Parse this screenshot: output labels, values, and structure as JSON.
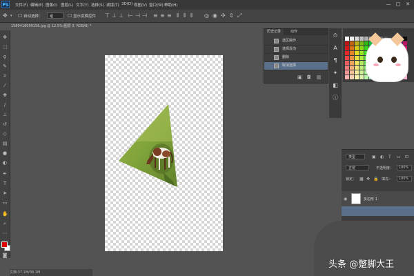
{
  "app": {
    "logo": "Ps"
  },
  "menubar": {
    "items": [
      "文件(F)",
      "编辑(E)",
      "图像(I)",
      "图层(L)",
      "文字(Y)",
      "选择(S)",
      "滤镜(T)",
      "3D(D)",
      "视图(V)",
      "窗口(W)",
      "帮助(H)"
    ],
    "window_controls": [
      "—",
      "□",
      "✕"
    ]
  },
  "optionsbar": {
    "auto_select_label": "自动选择：",
    "auto_select_value": "组",
    "show_transform_label": "显示变换控件"
  },
  "document": {
    "tab_title": "1580418099156.jpg @ 12.5%(图层 0, RGB/8) *",
    "status_text": "文档:37.1M/38.1M"
  },
  "history_panel": {
    "tabs": [
      "历史记录",
      "动作"
    ],
    "items": [
      "选区操作",
      "选择反向",
      "删除",
      "取消选择"
    ],
    "selected_index": 3
  },
  "layers_panel": {
    "kind_value": "类型",
    "blend_mode": "正常",
    "opacity_label": "不透明度：",
    "opacity_value": "100%",
    "lock_label": "锁定：",
    "fill_label": "填充：",
    "fill_value": "100%",
    "layer_name": "多边形 1"
  },
  "watermark": {
    "text": "头条 @蹩脚大王"
  },
  "colors": {
    "foreground": "#e00000",
    "background": "#ffffff",
    "selection": "#5a6f8a"
  }
}
